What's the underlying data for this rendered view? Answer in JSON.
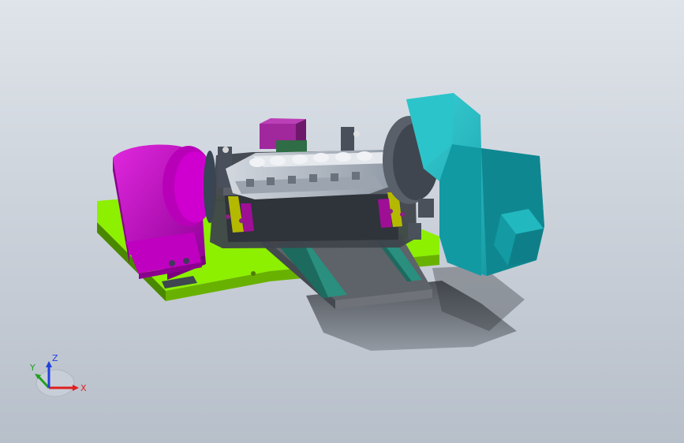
{
  "triad": {
    "x_label": "X",
    "y_label": "Y",
    "z_label": "Z",
    "x_color": "#e02020",
    "y_color": "#20a020",
    "z_color": "#2040e0"
  },
  "colors": {
    "background_top": "#dfe4ea",
    "background_bottom": "#b7bfca",
    "base_plate": "#8cf000",
    "left_motor": "#d000c8",
    "right_motor": "#18b8c0",
    "fixture_dark": "#4a4f58",
    "slide_plate": "#5d6168",
    "rail_teal": "#2c8a7a",
    "part": "#b8bec8",
    "accent_orange": "#c86a2a"
  }
}
